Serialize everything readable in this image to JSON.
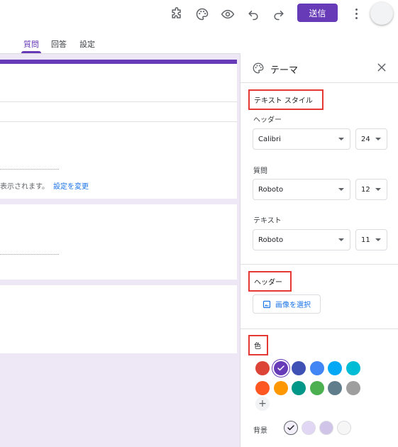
{
  "toolbar": {
    "send_label": "送信",
    "icons": [
      "puzzle-icon",
      "palette-icon",
      "eye-icon",
      "undo-icon",
      "redo-icon",
      "more-vert-icon"
    ]
  },
  "tabs": [
    {
      "label": "質問",
      "active": true
    },
    {
      "label": "回答",
      "active": false
    },
    {
      "label": "設定",
      "active": false
    }
  ],
  "form": {
    "card1_note": "表示されます。",
    "card1_link": "設定を変更"
  },
  "theme_panel": {
    "title": "テーマ",
    "text_style": {
      "title": "テキスト スタイル",
      "header": {
        "label": "ヘッダー",
        "font": "Calibri",
        "size": "24"
      },
      "question": {
        "label": "質問",
        "font": "Roboto",
        "size": "12"
      },
      "text": {
        "label": "テキスト",
        "font": "Roboto",
        "size": "11"
      }
    },
    "header_section": {
      "title": "ヘッダー",
      "button_label": "画像を選択"
    },
    "color_section": {
      "title": "色",
      "swatches": [
        "#db4437",
        "#673ab7",
        "#3f51b5",
        "#4285f4",
        "#03a9f4",
        "#00bcd4",
        "#ff5722",
        "#ff9800",
        "#009688",
        "#4caf50",
        "#607d8b",
        "#9e9e9e"
      ],
      "selected_index": 1,
      "add_label": "+",
      "background_label": "背景",
      "backgrounds": [
        "#f3effa",
        "#e1d7f5",
        "#d1c4e9",
        "#f6f6f6"
      ],
      "background_selected_index": 0
    }
  }
}
